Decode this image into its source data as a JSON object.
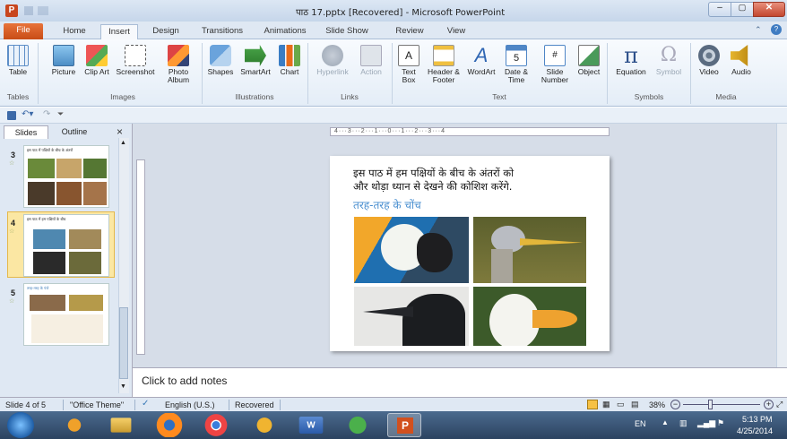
{
  "window": {
    "title": "पाठ 17.pptx [Recovered] - Microsoft PowerPoint"
  },
  "tabs": [
    "File",
    "Home",
    "Insert",
    "Design",
    "Transitions",
    "Animations",
    "Slide Show",
    "Review",
    "View"
  ],
  "ribbon": {
    "tables": {
      "table": "Table",
      "group": "Tables"
    },
    "images": {
      "picture": "Picture",
      "clipart": "Clip Art",
      "screenshot": "Screenshot",
      "photoalbum": "Photo Album",
      "group": "Images"
    },
    "illustrations": {
      "shapes": "Shapes",
      "smartart": "SmartArt",
      "chart": "Chart",
      "group": "Illustrations"
    },
    "links": {
      "hyperlink": "Hyperlink",
      "action": "Action",
      "group": "Links"
    },
    "text": {
      "textbox": "Text Box",
      "headerfooter": "Header & Footer",
      "wordart": "WordArt",
      "datetime": "Date & Time",
      "slidenumber": "Slide Number",
      "object": "Object",
      "group": "Text"
    },
    "symbols": {
      "equation": "Equation",
      "symbol": "Symbol",
      "group": "Symbols"
    },
    "media": {
      "video": "Video",
      "audio": "Audio",
      "group": "Media"
    }
  },
  "panel": {
    "tab_slides": "Slides",
    "tab_outline": "Outline",
    "close": "×"
  },
  "thumbs": [
    {
      "num": "3",
      "text": "इस पाठ में पक्षियों के बीच के अंतरों"
    },
    {
      "num": "4",
      "text": "इस पाठ में हम पक्षियों के बीच"
    },
    {
      "num": "5",
      "text": "तरह-तरह के पंजे"
    }
  ],
  "slide": {
    "line1": "इस पाठ में हम पक्षियों के बीच के अंतरों को",
    "line2": "और थोड़ा ध्यान से देखने की कोशिश करेंगे.",
    "subtitle": "तरह-तरह के चोंच"
  },
  "ruler": "4···3···2···1···0···1···2···3···4",
  "notes": "Click to add notes",
  "status": {
    "slide": "Slide 4 of 5",
    "theme": "\"Office Theme\"",
    "language": "English (U.S.)",
    "recovered": "Recovered",
    "zoom": "38%",
    "zoom_level": 38
  },
  "taskbar": {
    "lang": "EN",
    "time": "5:13 PM",
    "date": "4/25/2014"
  }
}
